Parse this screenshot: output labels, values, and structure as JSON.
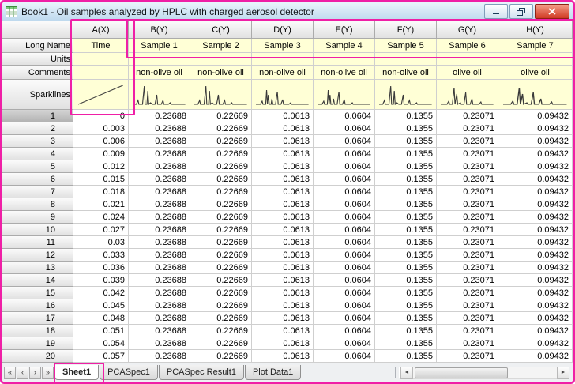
{
  "window": {
    "title": "Book1 - Oil samples analyzed by HPLC with charged aerosol detector"
  },
  "colors": {
    "highlight": "#ef1fa6",
    "header_yellow": "#ffffd6",
    "close_red": "#cf3a22"
  },
  "icons": {
    "scroll_left": "◄",
    "scroll_right": "►"
  },
  "grid": {
    "corner": "",
    "row_labels": [
      "Long Name",
      "Units",
      "Comments",
      "Sparklines"
    ],
    "columns": [
      {
        "header": "A(X)",
        "long_name": "Time",
        "units": "",
        "comments": "",
        "sparkline": "rising-line"
      },
      {
        "header": "B(Y)",
        "long_name": "Sample 1",
        "units": "",
        "comments": "non-olive oil",
        "sparkline": "peaks-a"
      },
      {
        "header": "C(Y)",
        "long_name": "Sample 2",
        "units": "",
        "comments": "non-olive oil",
        "sparkline": "peaks-a"
      },
      {
        "header": "D(Y)",
        "long_name": "Sample 3",
        "units": "",
        "comments": "non-olive oil",
        "sparkline": "peaks-b"
      },
      {
        "header": "E(Y)",
        "long_name": "Sample 4",
        "units": "",
        "comments": "non-olive oil",
        "sparkline": "peaks-b"
      },
      {
        "header": "F(Y)",
        "long_name": "Sample 5",
        "units": "",
        "comments": "non-olive oil",
        "sparkline": "peaks-a"
      },
      {
        "header": "G(Y)",
        "long_name": "Sample 6",
        "units": "",
        "comments": "olive oil",
        "sparkline": "peaks-c"
      },
      {
        "header": "H(Y)",
        "long_name": "Sample 7",
        "units": "",
        "comments": "olive oil",
        "sparkline": "peaks-c"
      }
    ],
    "rows": [
      {
        "n": "1",
        "v": [
          "0",
          "0.23688",
          "0.22669",
          "0.0613",
          "0.0604",
          "0.1355",
          "0.23071",
          "0.09432"
        ]
      },
      {
        "n": "2",
        "v": [
          "0.003",
          "0.23688",
          "0.22669",
          "0.0613",
          "0.0604",
          "0.1355",
          "0.23071",
          "0.09432"
        ]
      },
      {
        "n": "3",
        "v": [
          "0.006",
          "0.23688",
          "0.22669",
          "0.0613",
          "0.0604",
          "0.1355",
          "0.23071",
          "0.09432"
        ]
      },
      {
        "n": "4",
        "v": [
          "0.009",
          "0.23688",
          "0.22669",
          "0.0613",
          "0.0604",
          "0.1355",
          "0.23071",
          "0.09432"
        ]
      },
      {
        "n": "5",
        "v": [
          "0.012",
          "0.23688",
          "0.22669",
          "0.0613",
          "0.0604",
          "0.1355",
          "0.23071",
          "0.09432"
        ]
      },
      {
        "n": "6",
        "v": [
          "0.015",
          "0.23688",
          "0.22669",
          "0.0613",
          "0.0604",
          "0.1355",
          "0.23071",
          "0.09432"
        ]
      },
      {
        "n": "7",
        "v": [
          "0.018",
          "0.23688",
          "0.22669",
          "0.0613",
          "0.0604",
          "0.1355",
          "0.23071",
          "0.09432"
        ]
      },
      {
        "n": "8",
        "v": [
          "0.021",
          "0.23688",
          "0.22669",
          "0.0613",
          "0.0604",
          "0.1355",
          "0.23071",
          "0.09432"
        ]
      },
      {
        "n": "9",
        "v": [
          "0.024",
          "0.23688",
          "0.22669",
          "0.0613",
          "0.0604",
          "0.1355",
          "0.23071",
          "0.09432"
        ]
      },
      {
        "n": "10",
        "v": [
          "0.027",
          "0.23688",
          "0.22669",
          "0.0613",
          "0.0604",
          "0.1355",
          "0.23071",
          "0.09432"
        ]
      },
      {
        "n": "11",
        "v": [
          "0.03",
          "0.23688",
          "0.22669",
          "0.0613",
          "0.0604",
          "0.1355",
          "0.23071",
          "0.09432"
        ]
      },
      {
        "n": "12",
        "v": [
          "0.033",
          "0.23688",
          "0.22669",
          "0.0613",
          "0.0604",
          "0.1355",
          "0.23071",
          "0.09432"
        ]
      },
      {
        "n": "13",
        "v": [
          "0.036",
          "0.23688",
          "0.22669",
          "0.0613",
          "0.0604",
          "0.1355",
          "0.23071",
          "0.09432"
        ]
      },
      {
        "n": "14",
        "v": [
          "0.039",
          "0.23688",
          "0.22669",
          "0.0613",
          "0.0604",
          "0.1355",
          "0.23071",
          "0.09432"
        ]
      },
      {
        "n": "15",
        "v": [
          "0.042",
          "0.23688",
          "0.22669",
          "0.0613",
          "0.0604",
          "0.1355",
          "0.23071",
          "0.09432"
        ]
      },
      {
        "n": "16",
        "v": [
          "0.045",
          "0.23688",
          "0.22669",
          "0.0613",
          "0.0604",
          "0.1355",
          "0.23071",
          "0.09432"
        ]
      },
      {
        "n": "17",
        "v": [
          "0.048",
          "0.23688",
          "0.22669",
          "0.0613",
          "0.0604",
          "0.1355",
          "0.23071",
          "0.09432"
        ]
      },
      {
        "n": "18",
        "v": [
          "0.051",
          "0.23688",
          "0.22669",
          "0.0613",
          "0.0604",
          "0.1355",
          "0.23071",
          "0.09432"
        ]
      },
      {
        "n": "19",
        "v": [
          "0.054",
          "0.23688",
          "0.22669",
          "0.0613",
          "0.0604",
          "0.1355",
          "0.23071",
          "0.09432"
        ]
      },
      {
        "n": "20",
        "v": [
          "0.057",
          "0.23688",
          "0.22669",
          "0.0613",
          "0.0604",
          "0.1355",
          "0.23071",
          "0.09432"
        ]
      }
    ]
  },
  "tabs": {
    "nav": [
      {
        "name": "first",
        "glyph": "«"
      },
      {
        "name": "previous",
        "glyph": "‹"
      },
      {
        "name": "next",
        "glyph": "›"
      },
      {
        "name": "last",
        "glyph": "»"
      }
    ],
    "items": [
      {
        "label": "Sheet1",
        "active": true
      },
      {
        "label": "PCASpec1",
        "active": false
      },
      {
        "label": "PCASpec Result1",
        "active": false
      },
      {
        "label": "Plot Data1",
        "active": false
      }
    ]
  }
}
